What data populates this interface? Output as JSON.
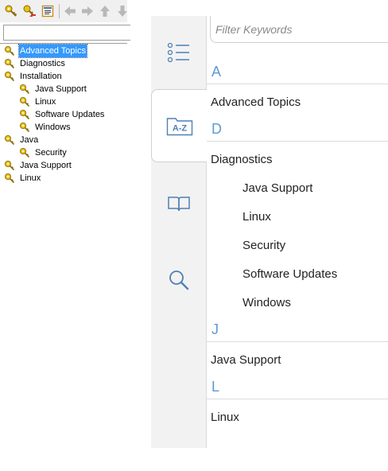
{
  "classic_panel": {
    "toolbar": {
      "buttons": [
        {
          "name": "key-icon",
          "label": "Index"
        },
        {
          "name": "key-sync-icon",
          "label": "Sync"
        },
        {
          "name": "print-topic-icon",
          "label": "Print"
        },
        {
          "name": "back-arrow-icon",
          "label": "Back"
        },
        {
          "name": "forward-arrow-icon",
          "label": "Forward"
        },
        {
          "name": "up-arrow-icon",
          "label": "Up"
        },
        {
          "name": "down-arrow-icon",
          "label": "Down"
        }
      ]
    },
    "search_value": "",
    "tree": [
      {
        "label": "Advanced Topics",
        "level": 0,
        "selected": true
      },
      {
        "label": "Diagnostics",
        "level": 0
      },
      {
        "label": "Installation",
        "level": 0
      },
      {
        "label": "Java Support",
        "level": 1
      },
      {
        "label": "Linux",
        "level": 1
      },
      {
        "label": "Software Updates",
        "level": 1
      },
      {
        "label": "Windows",
        "level": 1
      },
      {
        "label": "Java",
        "level": 0
      },
      {
        "label": "Security",
        "level": 1
      },
      {
        "label": "Java Support",
        "level": 0
      },
      {
        "label": "Linux",
        "level": 0
      }
    ]
  },
  "modern_panel": {
    "tabs": [
      {
        "name": "contents-tab",
        "icon": "list-icon",
        "active": false
      },
      {
        "name": "index-tab",
        "icon": "az-folder-icon",
        "label": "A-Z",
        "active": true
      },
      {
        "name": "bookmarks-tab",
        "icon": "book-icon",
        "active": false
      },
      {
        "name": "search-tab",
        "icon": "magnifier-icon",
        "active": false
      }
    ],
    "filter_placeholder": "Filter Keywords",
    "groups": [
      {
        "letter": "A",
        "entries": [
          {
            "label": "Advanced Topics",
            "sub": false
          }
        ]
      },
      {
        "letter": "D",
        "entries": [
          {
            "label": "Diagnostics",
            "sub": false
          },
          {
            "label": "Java Support",
            "sub": true
          },
          {
            "label": "Linux",
            "sub": true
          },
          {
            "label": "Security",
            "sub": true
          },
          {
            "label": "Software Updates",
            "sub": true
          },
          {
            "label": "Windows",
            "sub": true
          }
        ]
      },
      {
        "letter": "J",
        "entries": [
          {
            "label": "Java Support",
            "sub": false
          }
        ]
      },
      {
        "letter": "L",
        "entries": [
          {
            "label": "Linux",
            "sub": false
          }
        ]
      }
    ]
  },
  "colors": {
    "letter_accent": "#5b9bd5",
    "selection": "#3399ff",
    "tab_strip": "#f2f2f2",
    "icon_blue": "#4f7fb6"
  }
}
